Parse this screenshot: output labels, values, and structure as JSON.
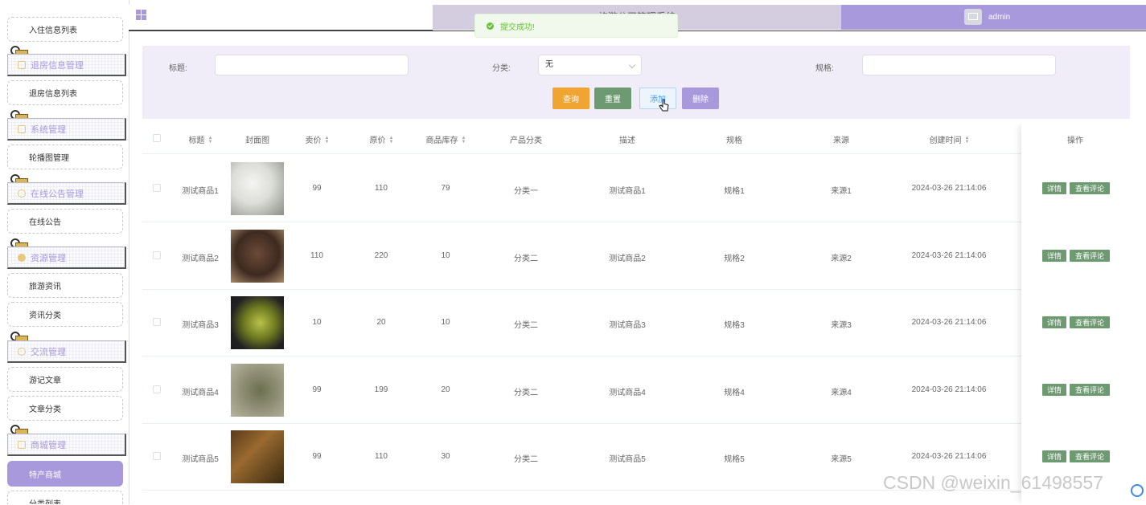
{
  "sidebar": {
    "top_item": "入住信息列表",
    "groups": [
      {
        "label": "退房信息管理",
        "items": [
          "退房信息列表"
        ]
      },
      {
        "label": "系统管理",
        "items": [
          "轮播图管理"
        ]
      },
      {
        "label": "在线公告管理",
        "items": [
          "在线公告"
        ]
      },
      {
        "label": "资源管理",
        "items": [
          "旅游资讯",
          "资讯分类"
        ]
      },
      {
        "label": "交流管理",
        "items": [
          "游记文章",
          "文章分类"
        ]
      },
      {
        "label": "商城管理",
        "items": [
          "特产商城",
          "分类列表"
        ]
      }
    ],
    "active_item": "特产商城"
  },
  "header": {
    "title": "旅游公司管理系统",
    "username": "admin"
  },
  "toast": {
    "message": "提交成功!"
  },
  "search": {
    "title_label": "标题:",
    "title_value": "",
    "category_label": "分类:",
    "category_value": "无",
    "spec_label": "规格:",
    "spec_value": "",
    "query_btn": "查询",
    "reset_btn": "重置",
    "add_btn": "添加",
    "delete_btn": "删除"
  },
  "table": {
    "headers": {
      "title": "标题",
      "cover": "封面图",
      "price": "卖价",
      "orig_price": "原价",
      "stock": "商品库存",
      "category": "产品分类",
      "desc": "描述",
      "spec": "规格",
      "source": "来源",
      "created": "创建时间",
      "ops": "操作"
    },
    "rows": [
      {
        "title": "测试商品1",
        "price": "99",
        "orig_price": "110",
        "stock": "79",
        "category": "分类一",
        "desc": "测试商品1",
        "spec": "规格1",
        "source": "来源1",
        "created": "2024-03-26 21:14:06"
      },
      {
        "title": "测试商品2",
        "price": "110",
        "orig_price": "220",
        "stock": "10",
        "category": "分类二",
        "desc": "测试商品2",
        "spec": "规格2",
        "source": "来源2",
        "created": "2024-03-26 21:14:06"
      },
      {
        "title": "测试商品3",
        "price": "10",
        "orig_price": "20",
        "stock": "10",
        "category": "分类二",
        "desc": "测试商品3",
        "spec": "规格3",
        "source": "来源3",
        "created": "2024-03-26 21:14:06"
      },
      {
        "title": "测试商品4",
        "price": "99",
        "orig_price": "199",
        "stock": "20",
        "category": "分类二",
        "desc": "测试商品4",
        "spec": "规格4",
        "source": "来源4",
        "created": "2024-03-26 21:14:06"
      },
      {
        "title": "测试商品5",
        "price": "99",
        "orig_price": "110",
        "stock": "30",
        "category": "分类二",
        "desc": "测试商品5",
        "spec": "规格5",
        "source": "来源5",
        "created": "2024-03-26 21:14:06"
      }
    ],
    "detail_btn": "详情",
    "comment_btn": "查看评论"
  },
  "watermark": "CSDN @weixin_61498557",
  "colors": {
    "accent": "#a898dc",
    "query": "#f0a432",
    "green": "#6e9a72"
  }
}
